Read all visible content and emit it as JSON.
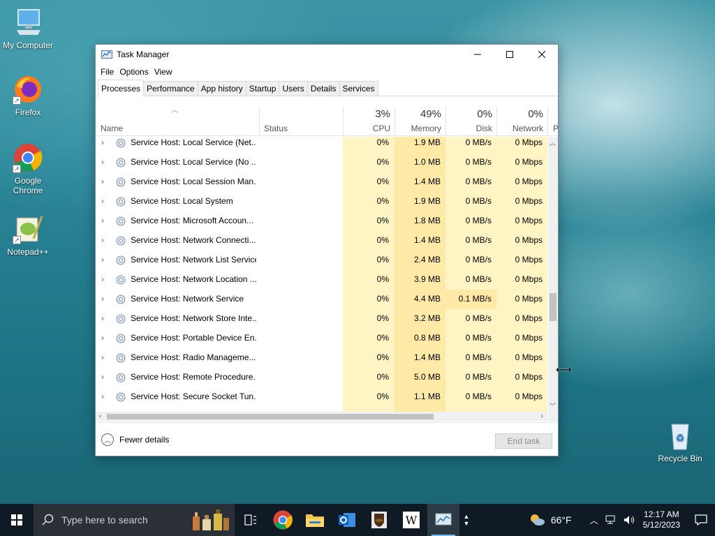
{
  "desktop": {
    "icons": [
      {
        "label": "My Computer"
      },
      {
        "label": "Firefox"
      },
      {
        "label": "Google Chrome"
      },
      {
        "label": "Notepad++"
      },
      {
        "label": "Recycle Bin"
      }
    ]
  },
  "window": {
    "title": "Task Manager",
    "menu": [
      "File",
      "Options",
      "View"
    ],
    "tabs": [
      "Processes",
      "Performance",
      "App history",
      "Startup",
      "Users",
      "Details",
      "Services"
    ],
    "active_tab": "Processes",
    "columns": {
      "name": "Name",
      "status": "Status",
      "cpu": {
        "pct": "3%",
        "label": "CPU"
      },
      "memory": {
        "pct": "49%",
        "label": "Memory"
      },
      "disk": {
        "pct": "0%",
        "label": "Disk"
      },
      "network": {
        "pct": "0%",
        "label": "Network"
      },
      "power": "P"
    },
    "rows": [
      {
        "name": "Service Host: Local Service (Net...",
        "cpu": "0%",
        "memory": "1.9 MB",
        "disk": "0 MB/s",
        "network": "0 Mbps"
      },
      {
        "name": "Service Host: Local Service (No ...",
        "cpu": "0%",
        "memory": "1.0 MB",
        "disk": "0 MB/s",
        "network": "0 Mbps"
      },
      {
        "name": "Service Host: Local Session Man...",
        "cpu": "0%",
        "memory": "1.4 MB",
        "disk": "0 MB/s",
        "network": "0 Mbps"
      },
      {
        "name": "Service Host: Local System",
        "cpu": "0%",
        "memory": "1.9 MB",
        "disk": "0 MB/s",
        "network": "0 Mbps"
      },
      {
        "name": "Service Host: Microsoft Accoun...",
        "cpu": "0%",
        "memory": "1.8 MB",
        "disk": "0 MB/s",
        "network": "0 Mbps"
      },
      {
        "name": "Service Host: Network Connecti...",
        "cpu": "0%",
        "memory": "1.4 MB",
        "disk": "0 MB/s",
        "network": "0 Mbps"
      },
      {
        "name": "Service Host: Network List Service",
        "cpu": "0%",
        "memory": "2.4 MB",
        "disk": "0 MB/s",
        "network": "0 Mbps"
      },
      {
        "name": "Service Host: Network Location ...",
        "cpu": "0%",
        "memory": "3.9 MB",
        "disk": "0 MB/s",
        "network": "0 Mbps"
      },
      {
        "name": "Service Host: Network Service",
        "cpu": "0%",
        "memory": "4.4 MB",
        "disk": "0.1 MB/s",
        "network": "0 Mbps"
      },
      {
        "name": "Service Host: Network Store Inte...",
        "cpu": "0%",
        "memory": "3.2 MB",
        "disk": "0 MB/s",
        "network": "0 Mbps"
      },
      {
        "name": "Service Host: Portable Device En...",
        "cpu": "0%",
        "memory": "0.8 MB",
        "disk": "0 MB/s",
        "network": "0 Mbps"
      },
      {
        "name": "Service Host: Radio Manageme...",
        "cpu": "0%",
        "memory": "1.4 MB",
        "disk": "0 MB/s",
        "network": "0 Mbps"
      },
      {
        "name": "Service Host: Remote Procedure...",
        "cpu": "0%",
        "memory": "5.0 MB",
        "disk": "0 MB/s",
        "network": "0 Mbps"
      },
      {
        "name": "Service Host: Secure Socket Tun...",
        "cpu": "0%",
        "memory": "1.1 MB",
        "disk": "0 MB/s",
        "network": "0 Mbps"
      }
    ],
    "footer": {
      "fewer_details": "Fewer details",
      "end_task": "End task"
    }
  },
  "taskbar": {
    "search_placeholder": "Type here to search",
    "weather": "66°F",
    "time": "12:17 AM",
    "date": "5/12/2023"
  },
  "colors": {
    "cpu_col": "#fff4c4",
    "mem_col": "#ffe9a6",
    "taskbar": "#0f1a24",
    "accent": "#76b9ed"
  }
}
